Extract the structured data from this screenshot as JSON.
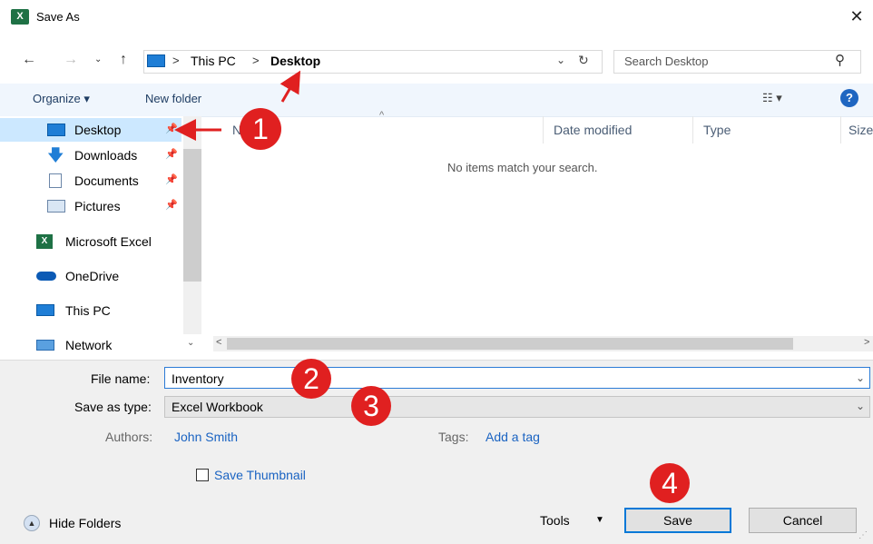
{
  "window": {
    "title": "Save As",
    "app_icon": "excel-icon",
    "app_icon_text": "X"
  },
  "addressbar": {
    "crumbs": [
      "This PC",
      "Desktop"
    ],
    "separator": ">"
  },
  "search": {
    "placeholder": "Search Desktop"
  },
  "toolbar": {
    "organize": "Organize ▾",
    "new_folder": "New folder"
  },
  "nav": {
    "quick": [
      {
        "label": "Desktop",
        "icon": "desktop-icon"
      },
      {
        "label": "Downloads",
        "icon": "downloads-icon"
      },
      {
        "label": "Documents",
        "icon": "documents-icon"
      },
      {
        "label": "Pictures",
        "icon": "pictures-icon"
      }
    ],
    "roots": [
      {
        "label": "Microsoft Excel",
        "icon": "excel-icon"
      },
      {
        "label": "OneDrive",
        "icon": "onedrive-icon"
      },
      {
        "label": "This PC",
        "icon": "this-pc-icon"
      },
      {
        "label": "Network",
        "icon": "network-icon"
      }
    ]
  },
  "filelist": {
    "columns": [
      "N",
      "Date modified",
      "Type",
      "Size"
    ],
    "empty_message": "No items match your search."
  },
  "form": {
    "file_name_label": "File name:",
    "file_name_value": "Inventory",
    "save_type_label": "Save as type:",
    "save_type_value": "Excel Workbook",
    "authors_label": "Authors:",
    "authors_value": "John Smith",
    "tags_label": "Tags:",
    "tags_value": "Add a tag",
    "thumbnail_label": "Save Thumbnail",
    "thumbnail_checked": false
  },
  "footer": {
    "hide_folders": "Hide Folders",
    "tools": "Tools",
    "save": "Save",
    "cancel": "Cancel"
  },
  "annotations": [
    "1",
    "2",
    "3",
    "4"
  ],
  "colors": {
    "accent": "#0078d7",
    "badge": "#e02020",
    "link": "#1a63c2",
    "selected": "#cce8ff"
  }
}
